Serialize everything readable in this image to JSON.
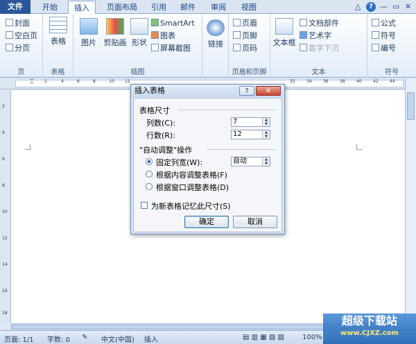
{
  "tabs": [
    "文件",
    "开始",
    "插入",
    "页面布局",
    "引用",
    "邮件",
    "审阅",
    "视图"
  ],
  "ribbon": {
    "pages": {
      "items": [
        "封面",
        "空白页",
        "分页"
      ],
      "label": "页"
    },
    "table": {
      "item": "表格",
      "label": "表格"
    },
    "illust": {
      "picture": "图片",
      "clipart": "剪贴画",
      "shape": "形状",
      "smartart": "SmartArt",
      "chart": "图表",
      "screenshot": "屏幕截图",
      "label": "插图"
    },
    "links": {
      "item": "链接"
    },
    "header": {
      "items": [
        "页眉",
        "页脚",
        "页码"
      ],
      "label": "页眉和页脚"
    },
    "text": {
      "textbox": "文本框",
      "items": [
        "文档部件",
        "艺术字",
        "首字下沉"
      ],
      "label": "文本"
    },
    "symbols": {
      "items": [
        "公式",
        "符号",
        "编号"
      ],
      "label": "符号"
    }
  },
  "ruler_ticks": [
    "2",
    "2",
    "4",
    "6",
    "8",
    "10",
    "12",
    "14",
    "16",
    "18",
    "20",
    "22",
    "24",
    "26",
    "28",
    "30",
    "32",
    "34",
    "36",
    "38",
    "40",
    "42",
    "44",
    "46"
  ],
  "vruler_ticks": [
    "2",
    "4",
    "6",
    "8",
    "10",
    "12",
    "14",
    "16",
    "18"
  ],
  "dialog": {
    "title": "插入表格",
    "help": "?",
    "close": "✕",
    "size_section": "表格尺寸",
    "cols_label": "列数(C):",
    "cols_value": "7",
    "rows_label": "行数(R):",
    "rows_value": "12",
    "autofit_section": "\"自动调整\"操作",
    "fixed_label": "固定列宽(W):",
    "fixed_value": "自动",
    "content_label": "根据内容调整表格(F)",
    "window_label": "根据窗口调整表格(D)",
    "remember_label": "为新表格记忆此尺寸(S)",
    "ok": "确定",
    "cancel": "取消"
  },
  "status": {
    "page": "页面: 1/1",
    "words": "字数: 0",
    "lang": "中文(中国)",
    "mode": "插入",
    "zoom": "100%"
  },
  "watermark": {
    "line1": "超级下载站",
    "line2": "www.CJXZ.com"
  }
}
